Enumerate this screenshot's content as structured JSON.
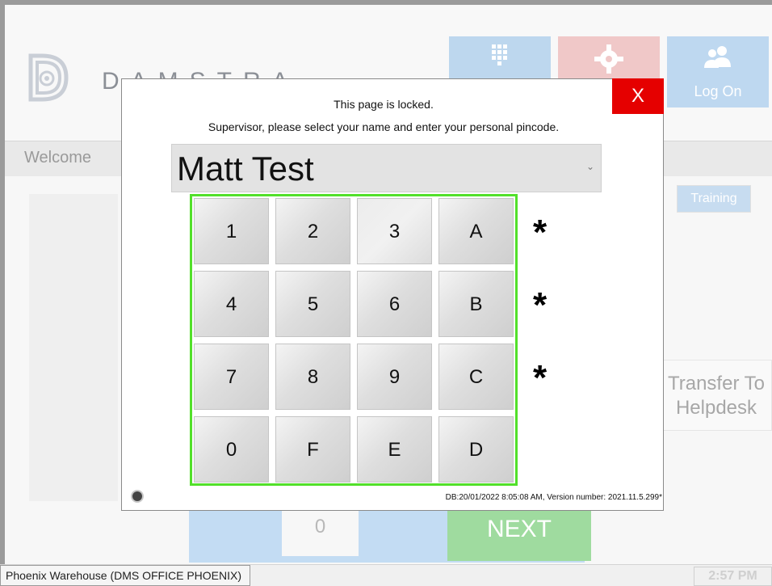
{
  "header": {
    "brand": "DAMSTRA",
    "tiles": [
      {
        "name": "keypad",
        "label": "",
        "icon": "keypad-icon"
      },
      {
        "name": "settings",
        "label": "",
        "icon": "gear-icon"
      },
      {
        "name": "logon",
        "label": "Log On",
        "icon": "users-icon"
      }
    ]
  },
  "welcome": "Welcome",
  "background_buttons": {
    "training": "Training",
    "transfer": "Transfer To\nHelpdesk",
    "zero": "0",
    "next": "NEXT"
  },
  "status": {
    "location": "Phoenix Warehouse (DMS OFFICE PHOENIX)",
    "time": "2:57 PM"
  },
  "modal": {
    "close_label": "X",
    "title": "This page is locked.",
    "message": "Supervisor, please select your name and enter your personal pincode.",
    "selected_user": "Matt Test",
    "keys": [
      "1",
      "2",
      "3",
      "A",
      "4",
      "5",
      "6",
      "B",
      "7",
      "8",
      "9",
      "C",
      "0",
      "F",
      "E",
      "D"
    ],
    "pin_mask": [
      "*",
      "*",
      "*"
    ],
    "version_info": "DB:20/01/2022 8:05:08 AM, Version number: 2021.11.5.299*"
  },
  "colors": {
    "close": "#e50000",
    "keypad_border": "#52e02a",
    "tile_blue": "#bdd7ee",
    "tile_red": "#f0c8c8",
    "next_green": "#9fdb9f"
  }
}
